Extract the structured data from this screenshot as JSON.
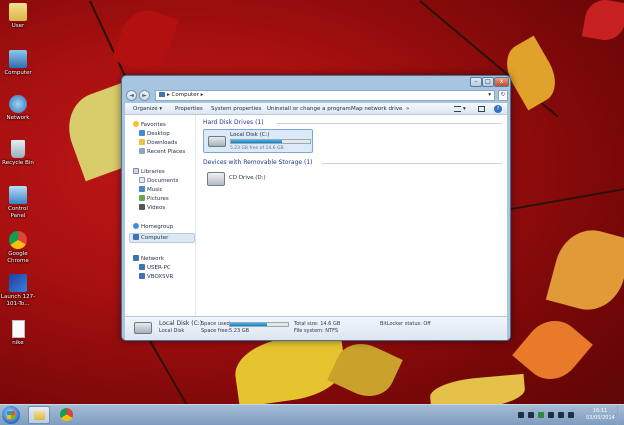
{
  "desktop": {
    "icons": [
      {
        "label": "User",
        "icon": "folder-icon"
      },
      {
        "label": "Computer",
        "icon": "computer-icon"
      },
      {
        "label": "Network",
        "icon": "network-icon"
      },
      {
        "label": "Recycle Bin",
        "icon": "recycle-bin-icon"
      },
      {
        "label": "Control Panel",
        "icon": "control-panel-icon"
      },
      {
        "label": "Google Chrome",
        "icon": "chrome-icon"
      },
      {
        "label": "Launch 127-101-To...",
        "icon": "launcher-icon"
      },
      {
        "label": "nike",
        "icon": "document-icon"
      }
    ]
  },
  "explorer": {
    "address": {
      "root_glyph": "▸",
      "path": "Computer",
      "separator": "▸",
      "back": "◄",
      "forward": "►",
      "dropdown": "▾",
      "refresh": "↻"
    },
    "window_buttons": {
      "minimize": "–",
      "maximize": "□",
      "close": "x"
    },
    "toolbar": {
      "organize": "Organize ▾",
      "properties": "Properties",
      "system_properties": "System properties",
      "uninstall": "Uninstall or change a program",
      "map_drive": "Map network drive",
      "more": "»",
      "views": "▾",
      "help": "?"
    },
    "nav": {
      "favorites": "Favorites",
      "desktop": "Desktop",
      "downloads": "Downloads",
      "recent": "Recent Places",
      "libraries": "Libraries",
      "documents": "Documents",
      "music": "Music",
      "pictures": "Pictures",
      "videos": "Videos",
      "homegroup": "Homegroup",
      "computer": "Computer",
      "network": "Network",
      "user_pc": "USER-PC",
      "vboxsvr": "VBOXSVR"
    },
    "content": {
      "hdd_header": "Hard Disk Drives (1)",
      "local_disk_name": "Local Disk (C:)",
      "local_disk_free": "5.23 GB free of 14.6 GB",
      "local_disk_used_fraction": 0.64,
      "removable_header": "Devices with Removable Storage (1)",
      "cd_drive": "CD Drive (D:)"
    },
    "details": {
      "name": "Local Disk (C:)",
      "type": "Local Disk",
      "space_used_label": "Space used:",
      "space_free_label": "Space free:",
      "space_free": "5.23 GB",
      "total_size": "Total size: 14.6 GB",
      "filesystem": "File system: NTFS",
      "bitlocker": "BitLocker status: Off"
    }
  },
  "taskbar": {
    "time": "16:11",
    "date": "03/05/2014"
  }
}
